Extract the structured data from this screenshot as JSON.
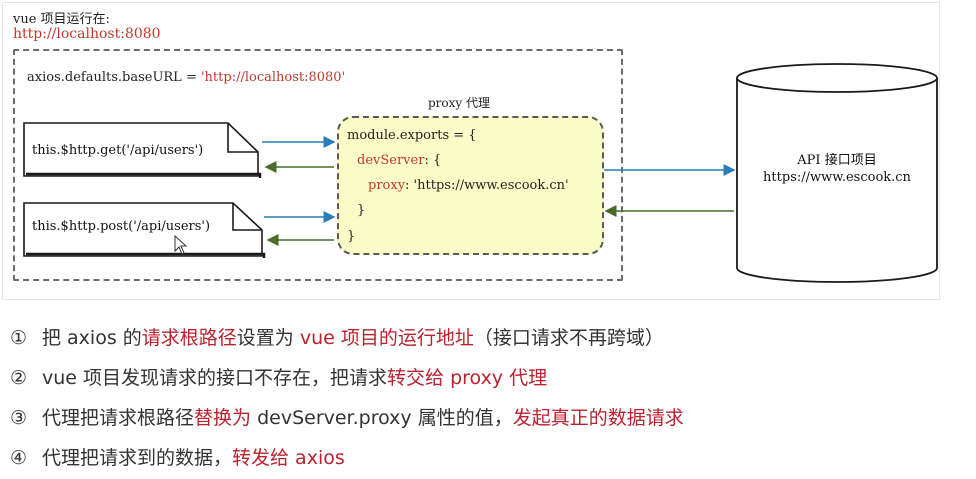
{
  "vue_project": {
    "label": "vue 项目运行在:",
    "url": "http://localhost:8080"
  },
  "axios_config": {
    "prefix": "axios.defaults.baseURL = ",
    "value": "'http://localhost:8080'"
  },
  "proxy": {
    "label": "proxy 代理",
    "code": {
      "line1": "module.exports = {",
      "line2_key": "devServer",
      "line2_rest": ": {",
      "line3_key": "proxy",
      "line3_rest": ": 'https://www.escook.cn'",
      "line4": "}",
      "line5": "}"
    }
  },
  "requests": {
    "get": "this.$http.get('/api/users')",
    "post": "this.$http.post('/api/users')"
  },
  "api_server": {
    "title": "API 接口项目",
    "url": "https://www.escook.cn"
  },
  "steps": [
    {
      "num": "①",
      "parts": [
        {
          "t": "把 axios 的",
          "hl": false
        },
        {
          "t": "请求根路径",
          "hl": true
        },
        {
          "t": "设置为 ",
          "hl": false
        },
        {
          "t": "vue 项目的运行地址",
          "hl": true
        },
        {
          "t": "（接口请求不再跨域）",
          "hl": false
        }
      ]
    },
    {
      "num": "②",
      "parts": [
        {
          "t": "vue 项目发现请求的接口不存在，把请求",
          "hl": false
        },
        {
          "t": "转交给 proxy 代理",
          "hl": true
        }
      ]
    },
    {
      "num": "③",
      "parts": [
        {
          "t": "代理把请求根路径",
          "hl": false
        },
        {
          "t": "替换为",
          "hl": true
        },
        {
          "t": " devServer.proxy 属性的值，",
          "hl": false
        },
        {
          "t": "发起真正的数据请求",
          "hl": true
        }
      ]
    },
    {
      "num": "④",
      "parts": [
        {
          "t": "代理把请求到的数据，",
          "hl": false
        },
        {
          "t": "转发给 axios",
          "hl": true
        }
      ]
    }
  ],
  "colors": {
    "highlight": "#b8232f",
    "url_red": "#c0392b",
    "arrow_blue": "#2a7fb8",
    "arrow_green": "#4a6b2a",
    "proxy_fill": "#fbfbc8"
  }
}
